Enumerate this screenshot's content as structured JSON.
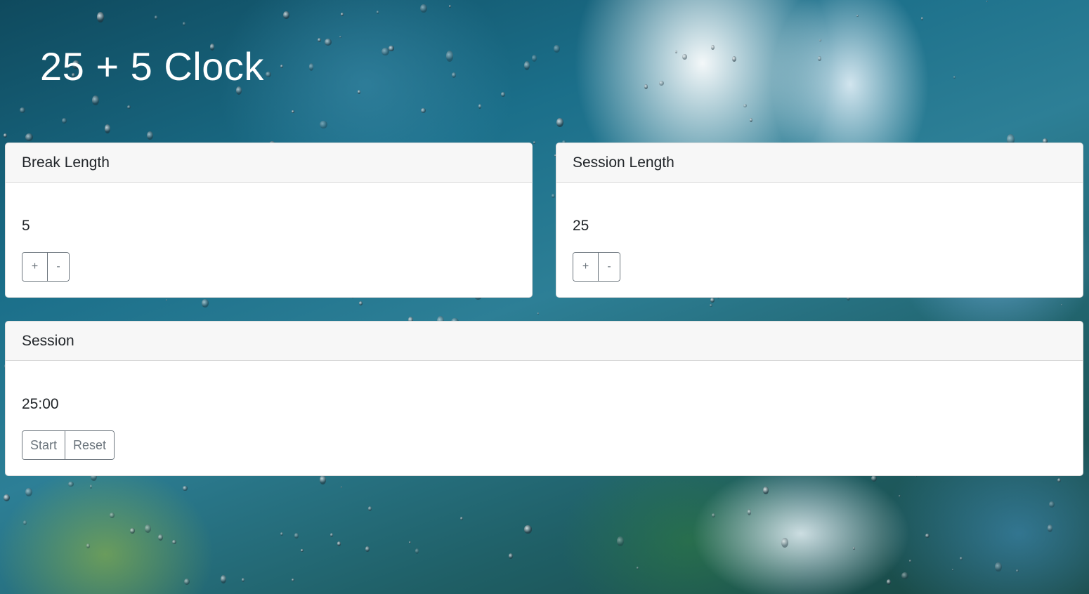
{
  "page": {
    "title": "25 + 5 Clock"
  },
  "break_card": {
    "header": "Break Length",
    "value": "5",
    "increment_label": "+",
    "decrement_label": "-"
  },
  "session_length_card": {
    "header": "Session Length",
    "value": "25",
    "increment_label": "+",
    "decrement_label": "-"
  },
  "timer_card": {
    "header": "Session",
    "time": "25:00",
    "start_label": "Start",
    "reset_label": "Reset"
  },
  "colors": {
    "button_text": "#6c757d",
    "card_header_bg": "#f7f7f7",
    "title_text": "#ffffff"
  },
  "background": {
    "description_icon": "rainy-window-background"
  }
}
